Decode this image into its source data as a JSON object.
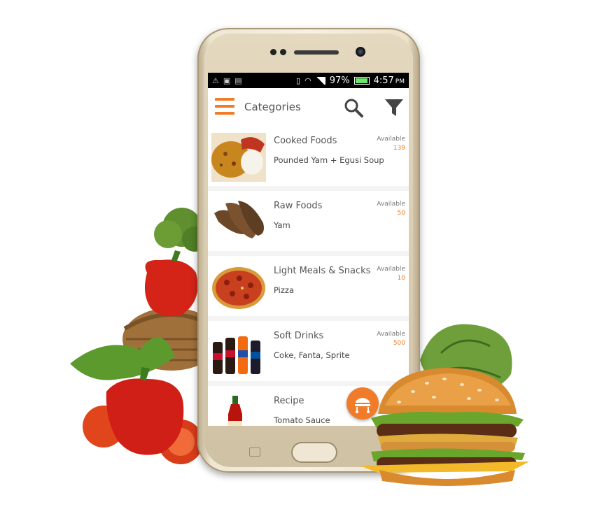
{
  "status_bar": {
    "battery_percent": "97%",
    "time": "4:57",
    "ampm": "PM"
  },
  "app_bar": {
    "title": "Categories",
    "menu_icon": "hamburger-menu-icon",
    "search_icon": "search-icon",
    "filter_icon": "filter-icon"
  },
  "categories": [
    {
      "title": "Cooked Foods",
      "subtitle": "Pounded Yam + Egusi Soup",
      "available_label": "Available",
      "available_count": "139",
      "image": "rice-dish-image"
    },
    {
      "title": "Raw Foods",
      "subtitle": "Yam",
      "available_label": "Available",
      "available_count": "50",
      "image": "yam-image"
    },
    {
      "title": "Light Meals & Snacks",
      "subtitle": "Pizza",
      "available_label": "Available",
      "available_count": "10",
      "image": "pizza-image"
    },
    {
      "title": "Soft Drinks",
      "subtitle": "Coke, Fanta, Sprite",
      "available_label": "Available",
      "available_count": "500",
      "image": "soft-drinks-image"
    },
    {
      "title": "Recipe",
      "subtitle": "Tomato Sauce",
      "image": "tomato-sauce-image"
    }
  ],
  "fab": {
    "icon": "cart-icon"
  },
  "colors": {
    "accent": "#f07c2a",
    "statusbar": "#000000",
    "screen_bg": "#f4f4f4"
  }
}
